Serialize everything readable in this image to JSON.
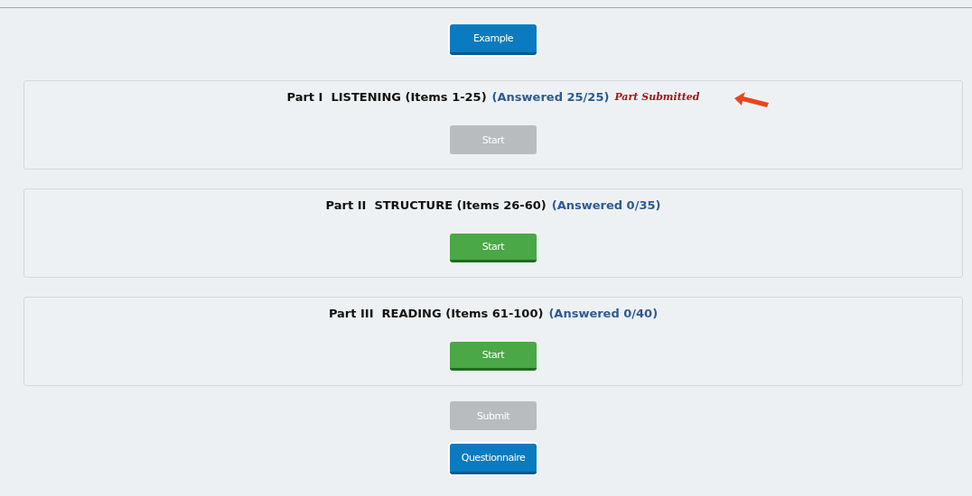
{
  "example_button": {
    "label": "Example"
  },
  "parts": [
    {
      "part": "Part I",
      "title": "LISTENING (Items 1-25)",
      "answered": "(Answered 25/25)",
      "status": "Part Submitted",
      "pointer": true,
      "start": {
        "label": "Start",
        "disabled": true
      }
    },
    {
      "part": "Part II",
      "title": "STRUCTURE (Items 26-60)",
      "answered": "(Answered 0/35)",
      "pointer": false,
      "start": {
        "label": "Start",
        "disabled": false
      }
    },
    {
      "part": "Part III",
      "title": "READING (Items 61-100)",
      "answered": "(Answered 0/40)",
      "pointer": false,
      "start": {
        "label": "Start",
        "disabled": false
      }
    }
  ],
  "submit_button": {
    "label": "Submit",
    "disabled": true
  },
  "questionnaire_button": {
    "label": "Questionnaire"
  }
}
